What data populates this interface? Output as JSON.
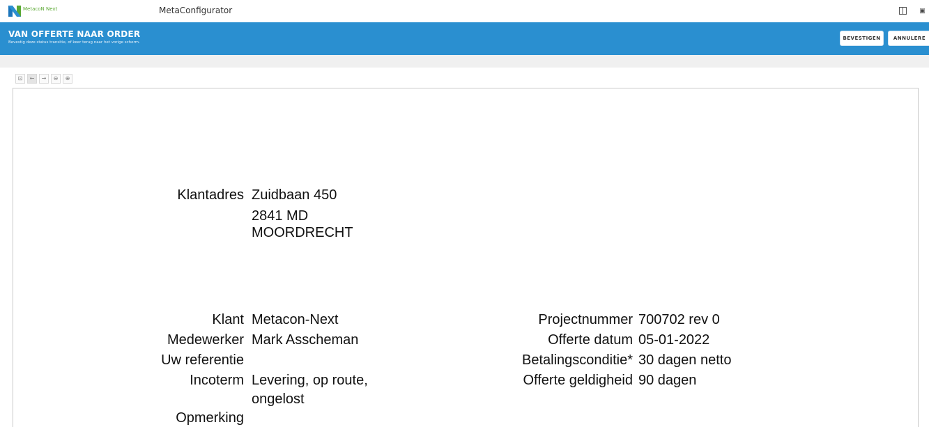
{
  "topbar": {
    "logo_text": "MetacoN Next",
    "app_title": "MetaConfigurator",
    "icons": [
      "layout-icon",
      "user-icon"
    ]
  },
  "header": {
    "title": "VAN OFFERTE NAAR ORDER",
    "subtitle": "Bevestig deze status transitie, of keer terug naar het vorige scherm.",
    "confirm_label": "BEVESTIGEN",
    "cancel_label": "ANNULERE"
  },
  "viewer_toolbar": {
    "buttons": [
      {
        "name": "save-icon",
        "glyph": "⊡"
      },
      {
        "name": "back-icon",
        "glyph": "←"
      },
      {
        "name": "forward-icon",
        "glyph": "→"
      },
      {
        "name": "zoom-out-icon",
        "glyph": "⊖"
      },
      {
        "name": "zoom-in-icon",
        "glyph": "⊕"
      }
    ]
  },
  "document": {
    "address": {
      "label": "Klantadres",
      "line1": "Zuidbaan 450",
      "line2": "2841 MD",
      "line3": "MOORDRECHT"
    },
    "left_fields": {
      "klant_label": "Klant",
      "klant_value": "Metacon-Next",
      "medewerker_label": "Medewerker",
      "medewerker_value": "Mark Asscheman",
      "referentie_label": "Uw referentie",
      "referentie_value": "",
      "incoterm_label": "Incoterm",
      "incoterm_value_line1": "Levering, op route,",
      "incoterm_value_line2": "ongelost",
      "opmerking_label": "Opmerking"
    },
    "right_fields": {
      "projectnummer_label": "Projectnummer",
      "projectnummer_value": "700702 rev 0",
      "datum_label": "Offerte datum",
      "datum_value": "05-01-2022",
      "betaling_label": "Betalingsconditie*",
      "betaling_value": "30 dagen netto",
      "geldigheid_label": "Offerte geldigheid",
      "geldigheid_value": "90 dagen"
    }
  },
  "colors": {
    "header_blue": "#2a8fd0",
    "logo_green": "#5aa832",
    "logo_blue": "#1b75bb"
  }
}
